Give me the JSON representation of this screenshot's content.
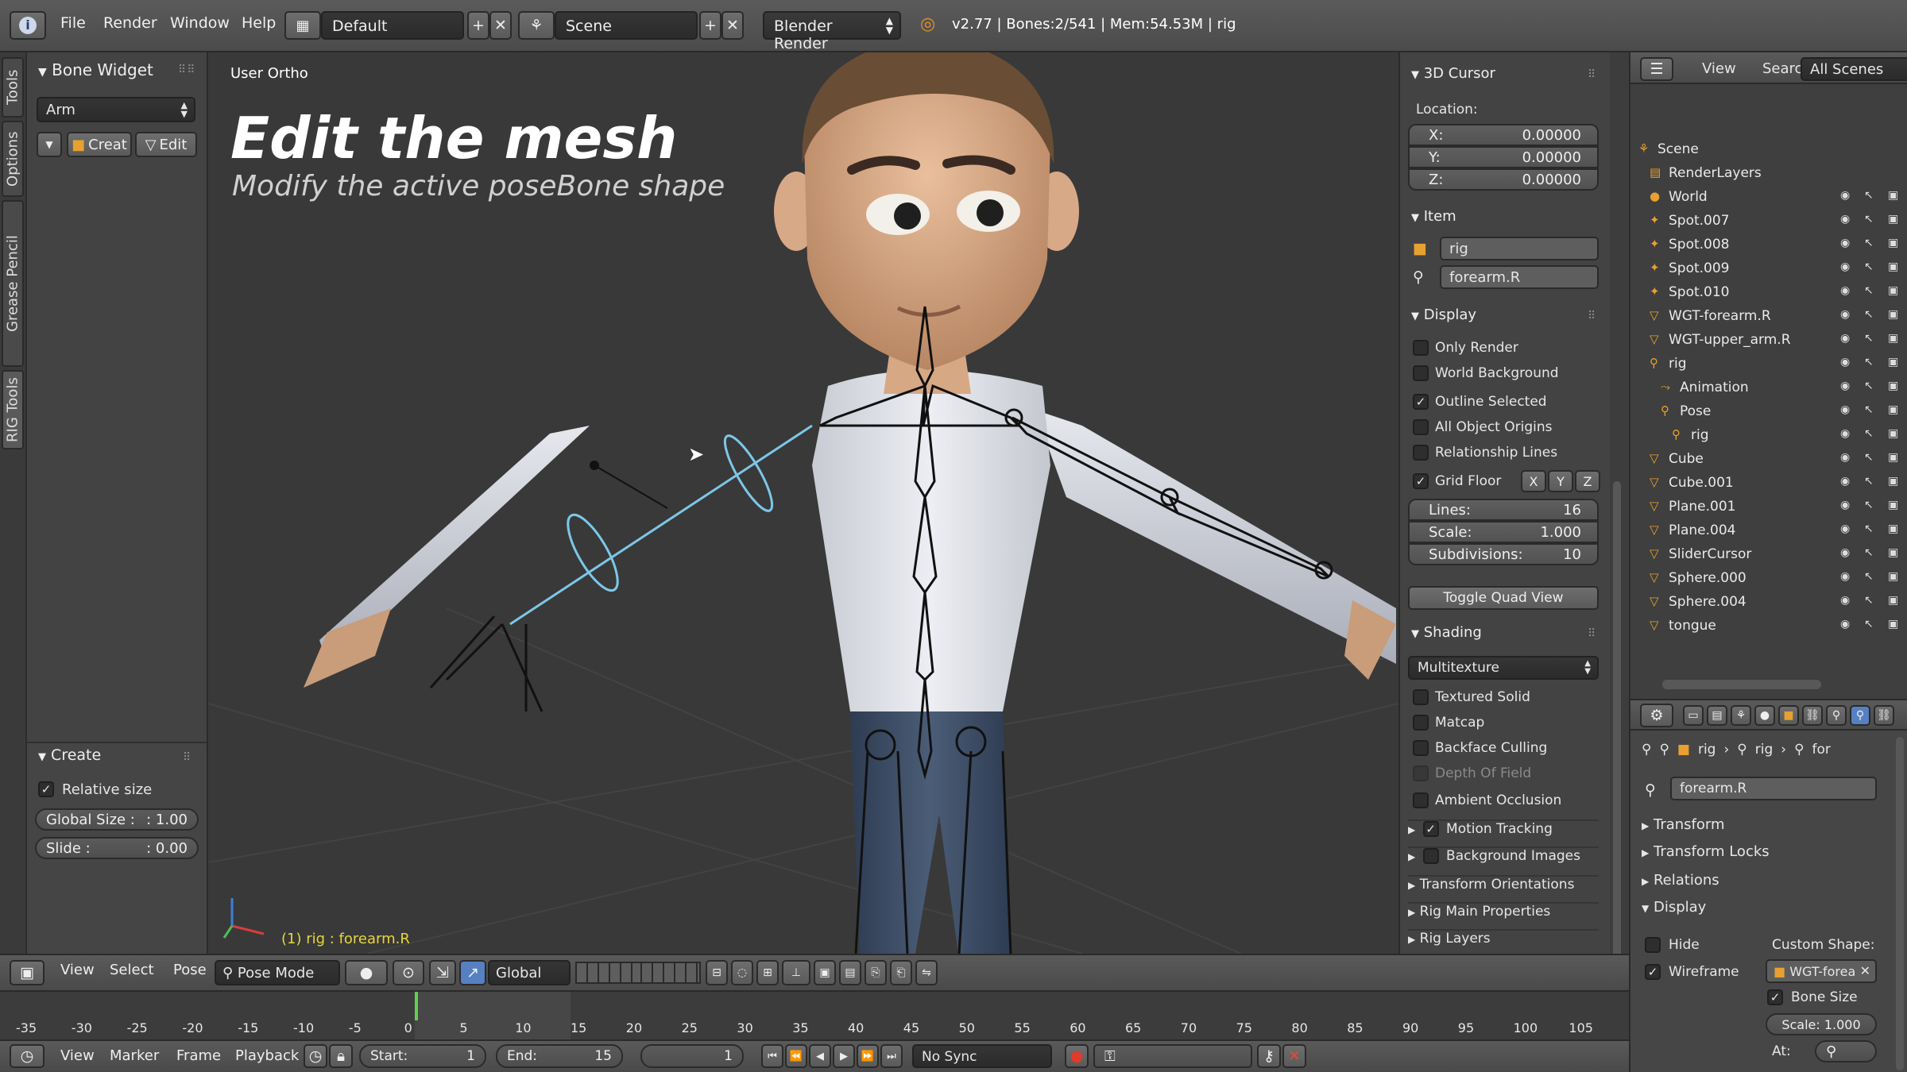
{
  "topbar": {
    "menus": [
      "File",
      "Render",
      "Window",
      "Help"
    ],
    "layout": "Default",
    "scene": "Scene",
    "engine": "Blender Render",
    "stats": "v2.77 | Bones:2/541 | Mem:54.53M | rig"
  },
  "tabs": [
    "Tools",
    "Options",
    "Grease Pencil",
    "RIG Tools"
  ],
  "toolshelf": {
    "bone_widget_title": "Bone Widget",
    "arm_select": "Arm",
    "create_label": "Creat",
    "edit_label": "Edit",
    "create_panel_title": "Create",
    "relative_size": "Relative size",
    "global_size_label": "Global Size :",
    "global_size_value": ": 1.00",
    "slide_label": "Slide :",
    "slide_value": ": 0.00"
  },
  "viewport": {
    "view_label": "User Ortho",
    "headline": "Edit the mesh",
    "subline": "Modify the active poseBone shape",
    "active": "(1) rig : forearm.R"
  },
  "npanel": {
    "cursor_title": "3D Cursor",
    "location_label": "Location:",
    "x_label": "X:",
    "x_value": "0.00000",
    "y_label": "Y:",
    "y_value": "0.00000",
    "z_label": "Z:",
    "z_value": "0.00000",
    "item_title": "Item",
    "item_object": "rig",
    "item_bone": "forearm.R",
    "display_title": "Display",
    "only_render": "Only Render",
    "world_background": "World Background",
    "outline_selected": "Outline Selected",
    "all_object_origins": "All Object Origins",
    "relationship_lines": "Relationship Lines",
    "grid_floor": "Grid Floor",
    "axis_x": "X",
    "axis_y": "Y",
    "axis_z": "Z",
    "lines_label": "Lines:",
    "lines_value": "16",
    "scale_label": "Scale:",
    "scale_value": "1.000",
    "subdiv_label": "Subdivisions:",
    "subdiv_value": "10",
    "toggle_quad": "Toggle Quad View",
    "shading_title": "Shading",
    "shading_mode": "Multitexture",
    "textured_solid": "Textured Solid",
    "matcap": "Matcap",
    "backface_culling": "Backface Culling",
    "depth_of_field": "Depth Of Field",
    "ambient_occlusion": "Ambient Occlusion",
    "motion_tracking": "Motion Tracking",
    "background_images": "Background Images",
    "transform_orientations": "Transform Orientations",
    "rig_main_properties": "Rig Main Properties",
    "rig_layers": "Rig Layers"
  },
  "outliner": {
    "view": "View",
    "search": "Search",
    "all_scenes": "All Scenes",
    "items": [
      {
        "label": "Scene",
        "indent": 0
      },
      {
        "label": "RenderLayers",
        "indent": 1
      },
      {
        "label": "World",
        "indent": 1
      },
      {
        "label": "Spot.007",
        "indent": 1
      },
      {
        "label": "Spot.008",
        "indent": 1
      },
      {
        "label": "Spot.009",
        "indent": 1
      },
      {
        "label": "Spot.010",
        "indent": 1
      },
      {
        "label": "WGT-forearm.R",
        "indent": 1
      },
      {
        "label": "WGT-upper_arm.R",
        "indent": 1
      },
      {
        "label": "rig",
        "indent": 1
      },
      {
        "label": "Animation",
        "indent": 2
      },
      {
        "label": "Pose",
        "indent": 2
      },
      {
        "label": "rig",
        "indent": 3
      },
      {
        "label": "Cube",
        "indent": 1
      },
      {
        "label": "Cube.001",
        "indent": 1
      },
      {
        "label": "Plane.001",
        "indent": 1
      },
      {
        "label": "Plane.004",
        "indent": 1
      },
      {
        "label": "SliderCursor",
        "indent": 1
      },
      {
        "label": "Sphere.000",
        "indent": 1
      },
      {
        "label": "Sphere.004",
        "indent": 1
      },
      {
        "label": "tongue",
        "indent": 1
      }
    ]
  },
  "props": {
    "crumb_obj": "rig",
    "crumb_arm": "rig",
    "crumb_bone": "for",
    "bone_name": "forearm.R",
    "transform": "Transform",
    "transform_locks": "Transform Locks",
    "relations": "Relations",
    "display": "Display",
    "hide": "Hide",
    "custom_shape": "Custom Shape:",
    "wireframe": "Wireframe",
    "shape_value": "WGT-forea",
    "bone_size": "Bone Size",
    "scale": "Scale: 1.000",
    "at": "At:"
  },
  "vheader": {
    "view": "View",
    "select": "Select",
    "pose": "Pose",
    "mode": "Pose Mode",
    "orientation": "Global"
  },
  "timeline": {
    "ticks": [
      "-35",
      "-30",
      "-25",
      "-20",
      "-15",
      "-10",
      "-5",
      "0",
      "5",
      "10",
      "15",
      "20",
      "25",
      "30",
      "35",
      "40",
      "45",
      "50",
      "55",
      "60",
      "65",
      "70",
      "75",
      "80",
      "85",
      "90",
      "95",
      "100",
      "105"
    ]
  },
  "tlheader": {
    "view": "View",
    "marker": "Marker",
    "frame": "Frame",
    "playback": "Playback",
    "start_label": "Start:",
    "start_value": "1",
    "end_label": "End:",
    "end_value": "15",
    "current": "1",
    "sync": "No Sync"
  },
  "colors": {
    "accent_blue": "#5680c2",
    "bone_orange": "#e8a030",
    "active_green": "#5fd04a",
    "stats_text": "#ffffff"
  }
}
